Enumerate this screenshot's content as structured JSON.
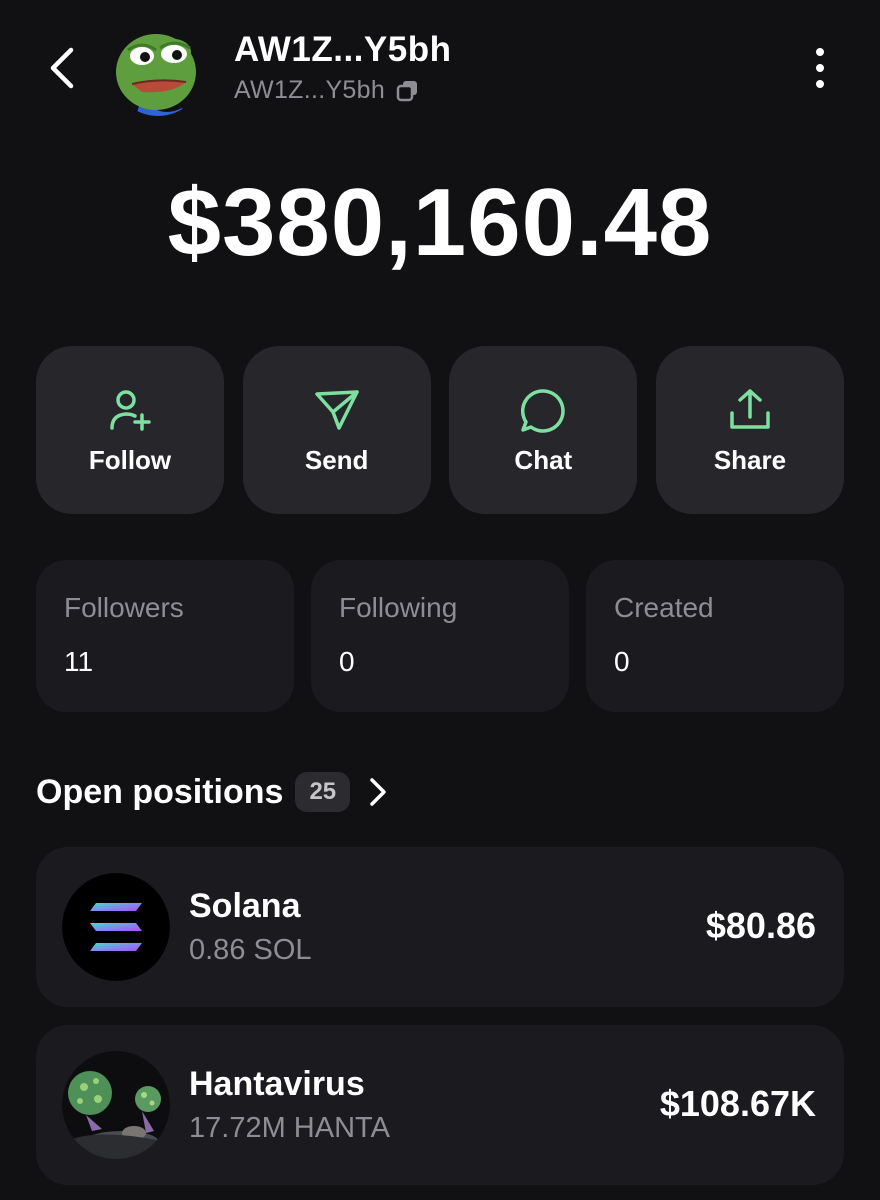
{
  "header": {
    "back_icon": "chevron-left-icon",
    "display_name": "AW1Z...Y5bh",
    "address": "AW1Z...Y5bh",
    "copy_icon": "copy-icon",
    "more_icon": "more-vertical-icon"
  },
  "balance": "$380,160.48",
  "actions": [
    {
      "label": "Follow",
      "icon": "user-plus-icon"
    },
    {
      "label": "Send",
      "icon": "send-icon"
    },
    {
      "label": "Chat",
      "icon": "chat-icon"
    },
    {
      "label": "Share",
      "icon": "share-icon"
    }
  ],
  "stats": [
    {
      "label": "Followers",
      "value": "11"
    },
    {
      "label": "Following",
      "value": "0"
    },
    {
      "label": "Created",
      "value": "0"
    }
  ],
  "positions_section": {
    "title": "Open positions",
    "count": "25"
  },
  "positions": [
    {
      "name": "Solana",
      "amount": "0.86 SOL",
      "value": "$80.86",
      "icon": "solana-logo"
    },
    {
      "name": "Hantavirus",
      "amount": "17.72M HANTA",
      "value": "$108.67K",
      "icon": "hanta-token-image"
    }
  ],
  "colors": {
    "background": "#111114",
    "card": "#26262b",
    "card_dark": "#1b1b1f",
    "accent_green": "#7ee0a0",
    "muted_text": "#8d8d93"
  }
}
